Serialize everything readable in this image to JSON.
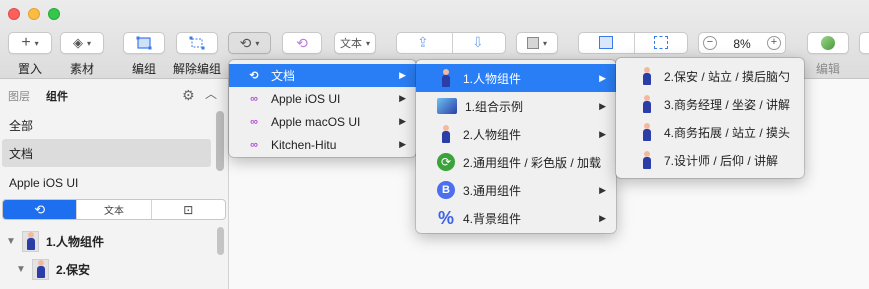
{
  "toolbar": {
    "insert_label": "置入",
    "material_label": "素材",
    "edit_label": "编组",
    "ungroup_label": "解除编组",
    "text_dropdown_label": "文本",
    "zoom_value": "8%",
    "edit2_label": "编辑"
  },
  "sidebar": {
    "tabs": [
      "图层",
      "组件"
    ],
    "rows": [
      "全部",
      "文档",
      "Apple iOS UI"
    ],
    "segments": [
      "",
      "文本",
      ""
    ],
    "tree": [
      "1.人物组件",
      "2.保安"
    ]
  },
  "menu1": {
    "items": [
      "文档",
      "Apple iOS UI",
      "Apple macOS UI",
      "Kitchen-Hitu"
    ]
  },
  "menu2": {
    "items": [
      "1.人物组件",
      "1.组合示例",
      "2.人物组件",
      "2.通用组件 / 彩色版 / 加载",
      "3.通用组件",
      "4.背景组件"
    ]
  },
  "menu3": {
    "items": [
      "2.保安 / 站立 / 摸后脑勺",
      "3.商务经理 / 坐姿 / 讲解",
      "4.商务拓展 / 站立 / 摸头",
      "7.设计师 / 后仰 / 讲解"
    ]
  },
  "colors": {
    "accent": "#2a7ef5",
    "segment_on": "#1e6ff0",
    "symbol_ring": "#b453d8"
  }
}
